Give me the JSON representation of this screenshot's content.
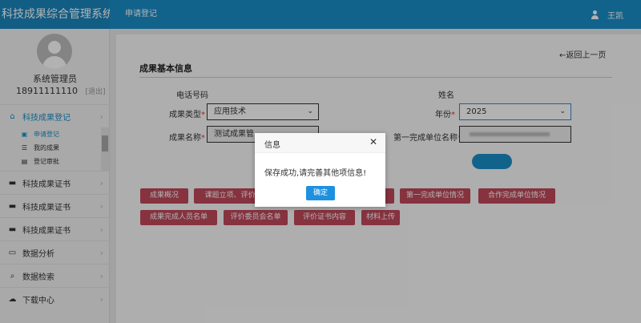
{
  "header": {
    "app_title": "科技成果综合管理系统",
    "breadcrumb": "申请登记",
    "user_name": "王凯"
  },
  "sidebar": {
    "role": "系统管理员",
    "phone": "18911111110",
    "logout": "[退出]",
    "menu_1": {
      "label": "科技成果登记",
      "icon": "home-icon"
    },
    "sub_items": [
      {
        "label": "申请登记",
        "icon": "form-icon"
      },
      {
        "label": "我的成果",
        "icon": "list-icon"
      },
      {
        "label": "登记审批",
        "icon": "approve-icon"
      }
    ],
    "menu_rest": [
      {
        "label": "科技成果证书",
        "icon": "certificate-icon"
      },
      {
        "label": "科技成果证书",
        "icon": "certificate-icon"
      },
      {
        "label": "科技成果证书",
        "icon": "certificate-icon"
      },
      {
        "label": "数据分析",
        "icon": "monitor-icon"
      },
      {
        "label": "数据检索",
        "icon": "search-icon"
      },
      {
        "label": "下载中心",
        "icon": "cloud-download-icon"
      }
    ]
  },
  "main": {
    "back_link": "←返回上一页",
    "section_title": "成果基本信息",
    "phone_label": "电话号码",
    "name_label": "姓名",
    "type_label": "成果类型",
    "type_value": "应用技术",
    "year_label": "年份",
    "year_value": "2025",
    "title_label": "成果名称",
    "title_value": "测试成果管",
    "unit_label": "第一完成单位名称",
    "required_mark": "*",
    "tags": [
      "成果概况",
      "课题立项、评价",
      "第一完成单位情况",
      "合作完成单位情况",
      "成果完成人员名单",
      "评价委员会名单",
      "评价证书内容",
      "材料上传"
    ]
  },
  "dialog": {
    "title": "信息",
    "close": "✕",
    "message": "保存成功,请完善其他项信息!",
    "ok_label": "确定"
  },
  "colors": {
    "header_blue": "#1b8fc9",
    "tag_red": "#c0485b",
    "ok_blue": "#1e90e0"
  }
}
